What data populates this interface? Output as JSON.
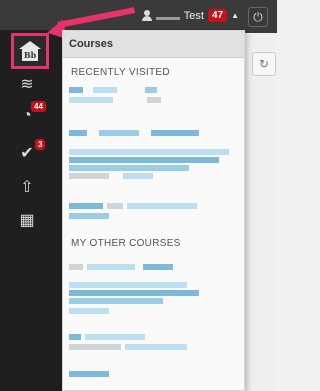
{
  "topbar": {
    "user_name": "Test",
    "notification_count": "47",
    "caret": "▲",
    "power_icon": "⏻"
  },
  "rail": {
    "home_label": "Bb",
    "items": [
      {
        "icon": "home-icon"
      },
      {
        "icon": "stream-icon",
        "glyph": "≋"
      },
      {
        "icon": "alarm-clock-icon",
        "glyph": "◔",
        "badge": "44"
      },
      {
        "icon": "checkmark-task-icon",
        "glyph": "✔",
        "badge": "3"
      },
      {
        "icon": "arrow-up-icon",
        "glyph": "⇧"
      },
      {
        "icon": "calendar-icon",
        "glyph": "▦"
      }
    ]
  },
  "flyout": {
    "title": "Courses",
    "recent_label": "RECENTLY VISITED",
    "other_label": "MY OTHER COURSES"
  },
  "background": {
    "dock_icon": "↻"
  },
  "colors": {
    "accent_pink": "#e8336a",
    "badge_red": "#c7101a",
    "rail_dark": "#1f1f1f",
    "pixelated_blue": "#8fc6e3"
  }
}
